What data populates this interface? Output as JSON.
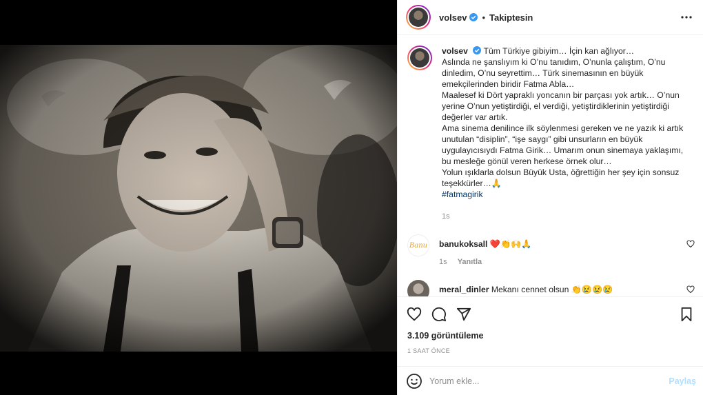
{
  "header": {
    "username": "volsev",
    "separator": "•",
    "follow_status": "Takiptesin"
  },
  "caption": {
    "username": "volsev",
    "text": "Tüm Türkiye gibiyim… İçin kan ağlıyor…\nAslında ne şanslıyım ki O’nu tanıdım, O’nunla çalıştım, O’nu dinledim, O’nu seyrettim… Türk sinemasının en büyük emekçilerinden biridir Fatma Abla…\nMaalesef ki Dört yapraklı yoncanın bir parçası yok artık… O’nun yerine O’nun yetiştirdiği, el verdiği, yetiştirdiklerinin yetiştirdiği değerler var artık.\nAma sinema denilince ilk söylenmesi gereken ve ne yazık ki artık unutulan “disiplin”, “işe saygı” gibi unsurların en büyük uygulayıcısıydı Fatma Girik… Umarım onun sinemaya yaklaşımı, bu mesleğe gönül veren herkese örnek olur…\nYolun ışıklarla dolsun Büyük Usta, öğrettiğin her şey için sonsuz teşekkürler…🙏",
    "hashtag": "#fatmagirik",
    "time": "1s"
  },
  "comments": [
    {
      "username": "banukoksall",
      "avatar_text": "Banu",
      "text": "❤️👏🙌🙏",
      "time": "1s",
      "reply_label": "Yanıtla"
    },
    {
      "username": "meral_dinler",
      "text": "Mekanı cennet olsun 👏😢😢😢"
    }
  ],
  "stats": {
    "views": "3.109 görüntüleme",
    "posted": "1 SAAT ÖNCE"
  },
  "add_comment": {
    "placeholder": "Yorum ekle...",
    "share_label": "Paylaş"
  },
  "colors": {
    "verified": "#3897f0",
    "like_red": "#ed4956",
    "link": "#00376b",
    "share_disabled": "#b2dffc"
  }
}
